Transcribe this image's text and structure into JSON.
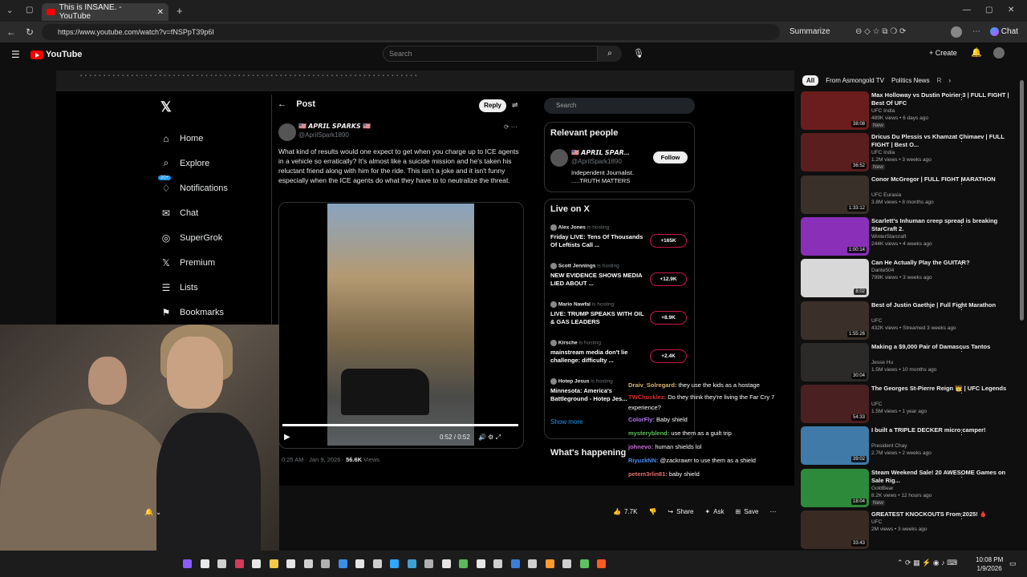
{
  "browser": {
    "tab_title": "This is INSANE. - YouTube",
    "url": "https://www.youtube.com/watch?v=fNSPpT39p6I",
    "summarize": "Summarize",
    "chat": "Chat"
  },
  "youtube": {
    "logo": "YouTube",
    "search_placeholder": "Search",
    "create": "Create",
    "likes": "7.7K",
    "share": "Share",
    "ask": "Ask",
    "save": "Save"
  },
  "x_app": {
    "nav": [
      "Home",
      "Explore",
      "Notifications",
      "Chat",
      "SuperGrok",
      "Premium",
      "Lists",
      "Bookmarks"
    ],
    "notif_badge": "20+",
    "post_header": "Post",
    "reply_label": "Reply",
    "search_placeholder": "Search",
    "author_name": "🇺🇸 𝘼𝙋𝙍𝙄𝙇 𝙎𝙋𝘼𝙍𝙆𝙎 🇺🇸",
    "author_handle": "@AprilSpark1890",
    "tweet_text": "What kind of results would one expect to get when you charge up to ICE agents in a vehicle so erratically?  It's almost like a suicide mission and he's taken his reluctant friend along with him for the ride.  This isn't a joke and it isn't funny especially when the ICE agents do what they have to to neutralize the threat.",
    "video_time": "0:52 / 0:52",
    "post_meta_time": "0:25 AM · Jan 9, 2026 ·",
    "post_meta_views": "56.6K",
    "post_meta_views_label": "Views",
    "relevant_header": "Relevant people",
    "relevant_name": "🇺🇸 𝘼𝙋𝙍𝙄𝙇 𝙎𝙋𝘼𝙍...",
    "relevant_handle": "@AprilSpark1890",
    "relevant_bio": "Independent Journalist. .....TRUTH MATTERS",
    "follow_label": "Follow",
    "live_header": "Live on X",
    "live_items": [
      {
        "host": "Alex Jones",
        "status": "is hosting",
        "title": "Friday LIVE: Tens Of Thousands Of Leftists Call ...",
        "count": "+165K"
      },
      {
        "host": "Scott Jennings",
        "status": "is hosting",
        "title": "NEW EVIDENCE SHOWS MEDIA LIED ABOUT ...",
        "count": "+12.9K"
      },
      {
        "host": "Mario Nawfal",
        "status": "is hosting",
        "title": "LIVE: TRUMP SPEAKS WITH OIL & GAS LEADERS",
        "count": "+8.9K"
      },
      {
        "host": "Kirsche",
        "status": "is hosting",
        "title": "mainstream media don't lie challenge: difficulty ...",
        "count": "+2.4K"
      },
      {
        "host": "Hotep Jesus",
        "status": "is hosting",
        "title": "Minnesota: America's Battleground - Hotep Jes...",
        "count": ""
      }
    ],
    "show_more": "Show more",
    "whats_happening": "What's happening"
  },
  "stream_chat": [
    {
      "user": "Draiv_Solregard:",
      "msg": "they use the kids as a hostage",
      "color": "#d7b56d"
    },
    {
      "user": "TWChucklez:",
      "msg": "Do they think they're living the Far Cry 7 experience?",
      "color": "#d22b2b"
    },
    {
      "user": "ColorFly:",
      "msg": "Baby shield",
      "color": "#b17af0"
    },
    {
      "user": "mysteryblend:",
      "msg": "use them as a guilt trip",
      "color": "#5ec05e"
    },
    {
      "user": "johnevo:",
      "msg": "human shields lol",
      "color": "#c86fd6"
    },
    {
      "user": "RiyuzkNN:",
      "msg": "@zackrawrr to use them as a shield",
      "color": "#4a8cf0"
    },
    {
      "user": "petem3rlin81:",
      "msg": "baby shield",
      "color": "#e07070"
    }
  ],
  "sidebar": {
    "chips": [
      "All",
      "From Asmongold TV",
      "Politics News",
      "R"
    ],
    "videos": [
      {
        "title": "Max Holloway vs Dustin Poirier 3 | FULL FIGHT | Best Of UFC",
        "channel": "UFC India",
        "views": "489K views • 6 days ago",
        "badge": "New",
        "duration": "38:08",
        "color": "#6b1d1d"
      },
      {
        "title": "Dricus Du Plessis vs Khamzat Chimaev | FULL FIGHT | Best O...",
        "channel": "UFC India",
        "views": "1.2M views • 3 weeks ago",
        "badge": "New",
        "duration": "36:52",
        "color": "#5a1e1e"
      },
      {
        "title": "Conor McGregor | FULL FIGHT MARATHON",
        "channel": "UFC Eurasia",
        "views": "3.8M views • 8 months ago",
        "badge": "",
        "duration": "1:33:12",
        "color": "#39302a"
      },
      {
        "title": "Scarlett's Inhuman creep spread is breaking StarCraft 2.",
        "channel": "WinterStarcraft",
        "views": "244K views • 4 weeks ago",
        "badge": "",
        "duration": "1:00:14",
        "color": "#8a2fb8"
      },
      {
        "title": "Can He Actually Play the GUITAR?",
        "channel": "Dante504",
        "views": "799K views • 3 weeks ago",
        "badge": "",
        "duration": "8:02",
        "color": "#d8d8d8"
      },
      {
        "title": "Best of Justin Gaethje | Full Fight Marathon",
        "channel": "UFC",
        "views": "432K views • Streamed 3 weeks ago",
        "badge": "",
        "duration": "1:55:26",
        "color": "#3b2f2a"
      },
      {
        "title": "Making a $9,000 Pair of Damascus Tantos",
        "channel": "Jesse Hu",
        "views": "1.5M views • 10 months ago",
        "badge": "",
        "duration": "30:04",
        "color": "#2c2a28"
      },
      {
        "title": "The Georges St-Pierre Reign 👑 | UFC Legends",
        "channel": "UFC",
        "views": "1.5M views • 1 year ago",
        "badge": "",
        "duration": "54:33",
        "color": "#4a2020"
      },
      {
        "title": "I built a TRIPLE DECKER micro camper!",
        "channel": "President Chay",
        "views": "2.7M views • 2 weeks ago",
        "badge": "",
        "duration": "39:02",
        "color": "#3f7aa8"
      },
      {
        "title": "Steam Weekend Sale! 20 AWESOME Games on Sale Rig...",
        "channel": "GoldBear",
        "views": "8.2K views • 12 hours ago",
        "badge": "New",
        "duration": "18:04",
        "color": "#2d8a3a"
      },
      {
        "title": "GREATEST KNOCKOUTS From 2025! 🩸",
        "channel": "UFC",
        "views": "2M views • 3 weeks ago",
        "badge": "",
        "duration": "33:43",
        "color": "#3a2a24"
      }
    ]
  },
  "taskbar": {
    "time": "10:08 PM",
    "date": "1/9/2026"
  }
}
